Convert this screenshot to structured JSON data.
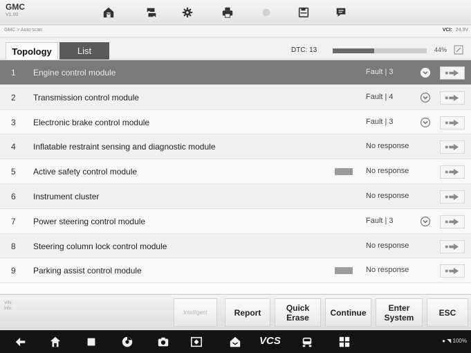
{
  "header": {
    "brand": "GMC",
    "version": "V1.00"
  },
  "breadcrumb": {
    "path": "GMC > Auto scan",
    "vci_label": "VCI:",
    "voltage": "24.3V"
  },
  "tabs": [
    {
      "label": "Topology",
      "active": false
    },
    {
      "label": "List",
      "active": true
    }
  ],
  "scan": {
    "dtc_label": "DTC: 13",
    "progress_percent": 44,
    "progress_text": "44%"
  },
  "modules": [
    {
      "num": "1",
      "name": "Engine control module",
      "status": "Fault | 3",
      "expandable": true,
      "tag": false,
      "selected": true
    },
    {
      "num": "2",
      "name": "Transmission control module",
      "status": "Fault | 4",
      "expandable": true,
      "tag": false,
      "selected": false
    },
    {
      "num": "3",
      "name": "Electronic brake control module",
      "status": "Fault | 3",
      "expandable": true,
      "tag": false,
      "selected": false
    },
    {
      "num": "4",
      "name": "Inflatable restraint sensing and diagnostic module",
      "status": "No response",
      "expandable": false,
      "tag": false,
      "selected": false
    },
    {
      "num": "5",
      "name": "Active safety control module",
      "status": "No response",
      "expandable": false,
      "tag": true,
      "selected": false
    },
    {
      "num": "6",
      "name": "Instrument cluster",
      "status": "No response",
      "expandable": false,
      "tag": false,
      "selected": false
    },
    {
      "num": "7",
      "name": "Power steering control module",
      "status": "Fault | 3",
      "expandable": true,
      "tag": false,
      "selected": false
    },
    {
      "num": "8",
      "name": "Steering column lock control module",
      "status": "No response",
      "expandable": false,
      "tag": false,
      "selected": false
    },
    {
      "num": "9",
      "name": "Parking assist control module",
      "status": "No response",
      "expandable": false,
      "tag": true,
      "selected": false
    }
  ],
  "vehicle_info": {
    "vin_label": "VIN:",
    "info_label": "Info:"
  },
  "actions": {
    "intelligent": "Intelligent",
    "report": "Report",
    "quick_erase": "Quick\nErase",
    "continue": "Continue",
    "enter_system": "Enter\nSystem",
    "esc": "ESC"
  },
  "navbar": {
    "vcs_label": "VCS",
    "battery": "100%"
  },
  "colors": {
    "selected_row": "#7a7a7a",
    "active_tab": "#5a5a5a",
    "progress_fill": "#6a6a6a"
  }
}
